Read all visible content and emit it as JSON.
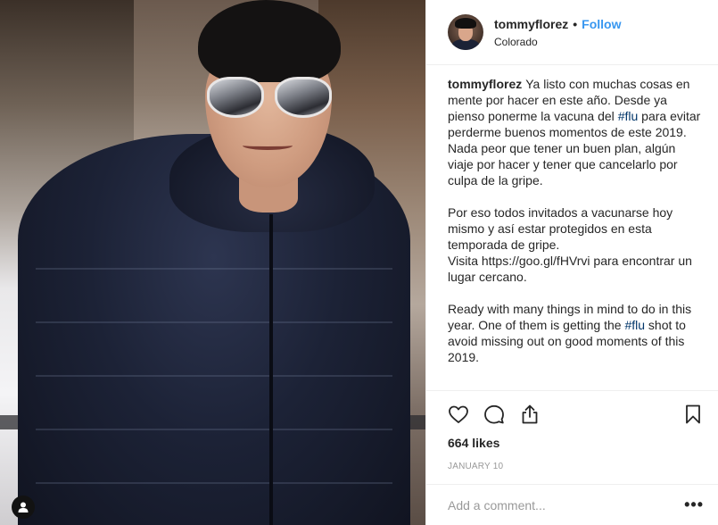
{
  "post": {
    "username": "tommyflorez",
    "separator": "•",
    "follow_label": "Follow",
    "location": "Colorado",
    "caption_username": "tommyflorez",
    "caption": {
      "p1_before": "Ya listo con muchas cosas en mente por hacer en este año. Desde ya pienso ponerme la vacuna del ",
      "p1_hashtag": "#flu",
      "p1_after": " para evitar perderme buenos momentos de este 2019.\nNada peor que tener un buen plan, algún viaje por hacer y tener que cancelarlo por culpa de la gripe.",
      "p2": "Por eso todos invitados a vacunarse hoy mismo y así estar protegidos en esta temporada de gripe.\nVisita https://goo.gl/fHVrvi para encontrar un lugar cercano.",
      "p3_before": "Ready with many things in mind to do in this year. One of them is getting the ",
      "p3_hashtag": "#flu",
      "p3_after": " shot to avoid missing out on good moments of this 2019."
    },
    "likes": "664 likes",
    "date": "JANUARY 10",
    "comment_placeholder": "Add a comment...",
    "more_label": "•••"
  },
  "icons": {
    "like": "heart-icon",
    "comment": "comment-bubble-icon",
    "share": "share-icon",
    "save": "bookmark-icon",
    "user_tag": "user-tag-icon"
  },
  "colors": {
    "follow": "#3897f0",
    "hashtag": "#003569",
    "muted": "#999999",
    "text": "#262626"
  }
}
